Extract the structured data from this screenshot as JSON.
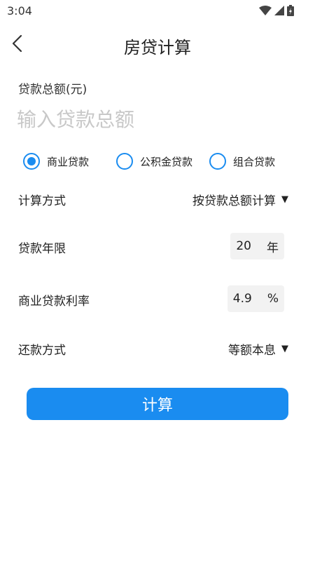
{
  "status_bar": {
    "time": "3:04"
  },
  "header": {
    "title": "房贷计算"
  },
  "loan_amount": {
    "label": "贷款总额(元)",
    "placeholder": "输入贷款总额",
    "value": ""
  },
  "loan_types": {
    "options": [
      "商业贷款",
      "公积金贷款",
      "组合贷款"
    ],
    "selected": "商业贷款"
  },
  "calc_method": {
    "label": "计算方式",
    "value": "按贷款总额计算"
  },
  "loan_term": {
    "label": "贷款年限",
    "value": "20",
    "unit": "年"
  },
  "interest_rate": {
    "label": "商业贷款利率",
    "value": "4.9",
    "unit": "%"
  },
  "repayment": {
    "label": "还款方式",
    "value": "等额本息"
  },
  "actions": {
    "calculate_label": "计算"
  },
  "colors": {
    "accent": "#1a8cf0",
    "input_bg": "#f2f2f2",
    "placeholder": "#c8c8c8"
  }
}
